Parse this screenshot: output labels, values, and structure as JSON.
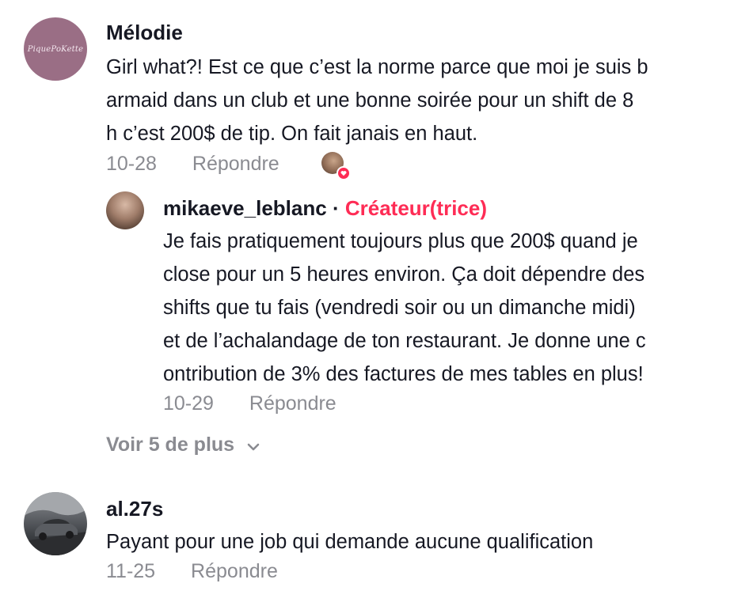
{
  "comments": [
    {
      "username": "Mélodie",
      "avatar_text": "PiquePoKette",
      "text": "Girl what?! Est ce que c’est la norme parce que moi je suis b\narmaid dans un club et une bonne soirée pour un shift de 8\nh c’est 200$ de tip. On fait janais en haut.",
      "date": "10-28",
      "reply_label": "Répondre",
      "liked_by_creator": true
    },
    {
      "username": "mikaeve_leblanc",
      "separator": "·",
      "badge": "Créateur(trice)",
      "text": "Je fais pratiquement toujours plus que 200$ quand je\nclose pour un 5 heures environ. Ça doit dépendre des\nshifts que tu fais (vendredi soir ou un dimanche midi)\net de l’achalandage de ton restaurant. Je donne une c\nontribution de 3% des factures de mes tables en plus!",
      "date": "10-29",
      "reply_label": "Répondre"
    },
    {
      "username": "al.27s",
      "text": "Payant pour une job qui demande aucune qualification",
      "date": "11-25",
      "reply_label": "Répondre"
    }
  ],
  "view_more": {
    "label": "Voir 5 de plus",
    "icon": "chevron-down-icon"
  },
  "colors": {
    "text": "#161823",
    "secondary": "#8a8b91",
    "accent": "#fe2c55",
    "melodie_avatar": "#9a6e85"
  }
}
